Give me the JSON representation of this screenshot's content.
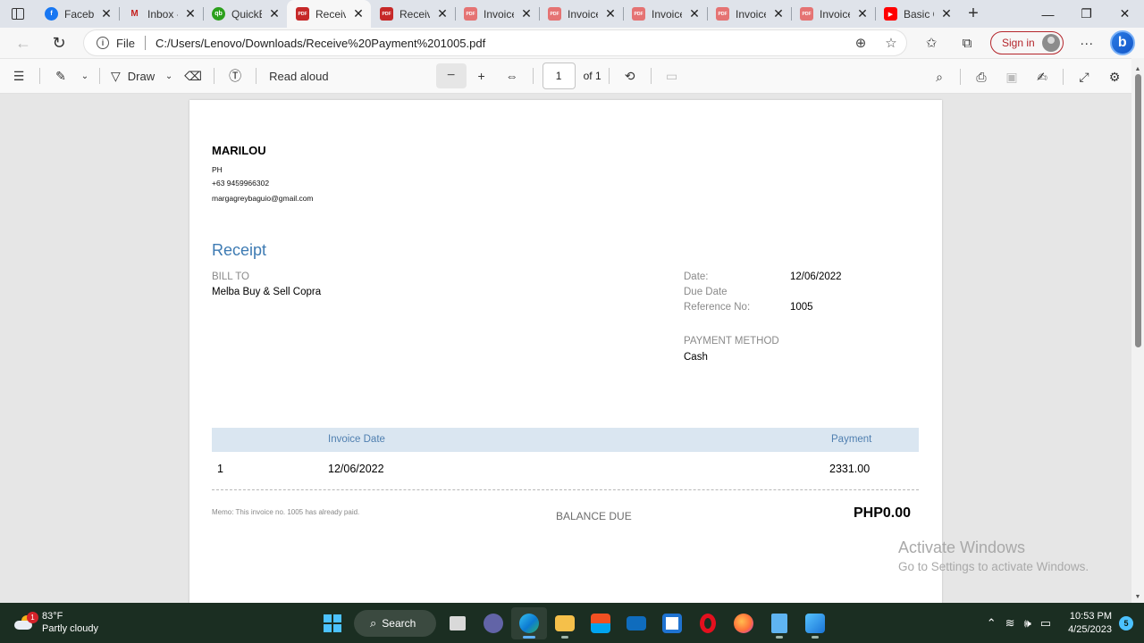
{
  "browser": {
    "tabs": [
      {
        "title": "Facebook",
        "favicon": "facebook-icon",
        "color": "#1877f2",
        "glyph": "f"
      },
      {
        "title": "Inbox - ",
        "favicon": "gmail-icon",
        "color": "#ffffff",
        "glyph": "M"
      },
      {
        "title": "QuickBooks",
        "favicon": "quickbooks-icon",
        "color": "#2ca01c",
        "glyph": "qb"
      },
      {
        "title": "Receive Payment",
        "favicon": "pdf-icon",
        "color": "#c62828",
        "glyph": "PDF",
        "active": true
      },
      {
        "title": "Receive Payment",
        "favicon": "pdf-icon",
        "color": "#c62828",
        "glyph": "PDF"
      },
      {
        "title": "Invoice",
        "favicon": "pdf-icon",
        "color": "#e57373",
        "glyph": "PDF"
      },
      {
        "title": "Invoice",
        "favicon": "pdf-icon",
        "color": "#e57373",
        "glyph": "PDF"
      },
      {
        "title": "Invoice",
        "favicon": "pdf-icon",
        "color": "#e57373",
        "glyph": "PDF"
      },
      {
        "title": "Invoice",
        "favicon": "pdf-icon",
        "color": "#e57373",
        "glyph": "PDF"
      },
      {
        "title": "Invoice",
        "favicon": "pdf-icon",
        "color": "#e57373",
        "glyph": "PDF"
      },
      {
        "title": "Basic Q",
        "favicon": "youtube-icon",
        "color": "#ff0000",
        "glyph": "▶"
      }
    ],
    "file_label": "File",
    "url": "C:/Users/Lenovo/Downloads/Receive%20Payment%201005.pdf",
    "sign_in": "Sign in"
  },
  "pdf_toolbar": {
    "draw_label": "Draw",
    "read_aloud": "Read aloud",
    "page_number": "1",
    "page_of": "of 1"
  },
  "document": {
    "company": {
      "name": "MARILOU",
      "country": "PH",
      "phone": "+63 9459966302",
      "email": "margagreybaguio@gmail.com"
    },
    "title": "Receipt",
    "bill_to_label": "BILL TO",
    "bill_to": "Melba Buy & Sell Copra",
    "date_label": "Date:",
    "date": "12/06/2022",
    "due_date_label": "Due Date",
    "ref_label": "Reference No:",
    "ref": "1005",
    "payment_method_label": "PAYMENT METHOD",
    "payment_method": "Cash",
    "table": {
      "headers": {
        "invoice_date": "Invoice Date",
        "payment": "Payment"
      },
      "rows": [
        {
          "num": "1",
          "invoice_date": "12/06/2022",
          "payment": "2331.00"
        }
      ]
    },
    "memo": "Memo: This invoice no. 1005 has already paid.",
    "balance_due_label": "BALANCE DUE",
    "balance_due": "PHP0.00"
  },
  "watermark": {
    "line1": "Activate Windows",
    "line2": "Go to Settings to activate Windows."
  },
  "taskbar": {
    "weather_badge": "1",
    "temperature": "83°F",
    "weather_desc": "Partly cloudy",
    "search_label": "Search",
    "time": "10:53 PM",
    "date": "4/25/2023",
    "notification_count": "5"
  }
}
